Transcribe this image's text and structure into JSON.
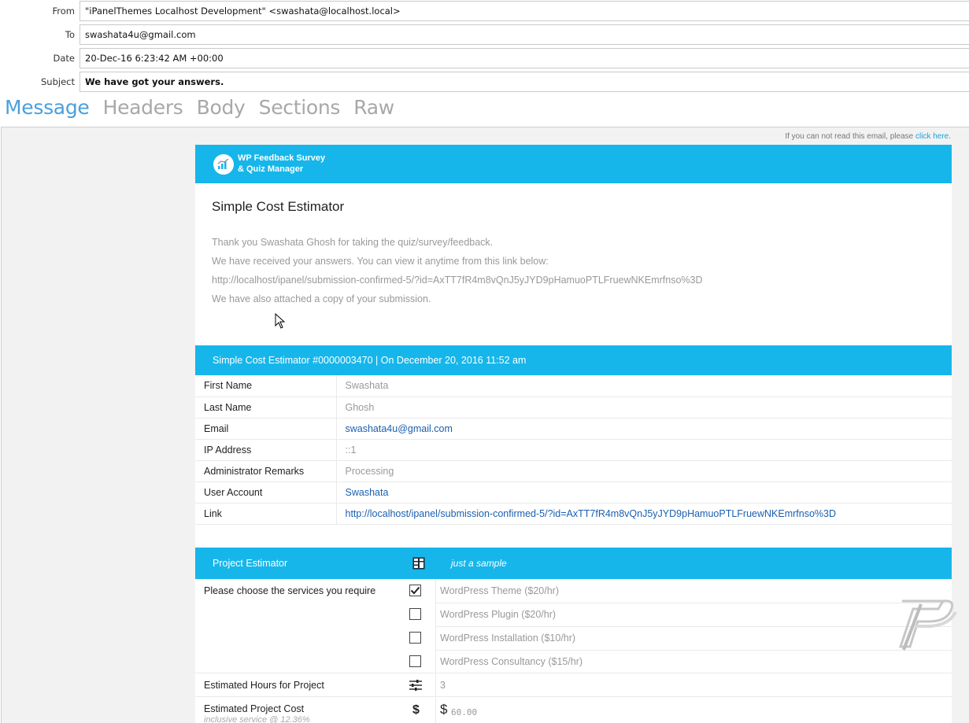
{
  "headers": {
    "from_label": "From",
    "from_value": "\"iPanelThemes Localhost Development\" <swashata@localhost.local>",
    "to_label": "To",
    "to_value": "swashata4u@gmail.com",
    "date_label": "Date",
    "date_value": "20-Dec-16 6:23:42 AM +00:00",
    "subject_label": "Subject",
    "subject_value": "We have got your answers."
  },
  "tabs": [
    "Message",
    "Headers",
    "Body",
    "Sections",
    "Raw"
  ],
  "preview": {
    "cantread_text": "If you can not read this email, please ",
    "cantread_link": "click here.",
    "brand_line1": "WP Feedback Survey",
    "brand_line2": "& Quiz Manager",
    "title": "Simple Cost Estimator",
    "intro": [
      "Thank you Swashata Ghosh for taking the quiz/survey/feedback.",
      "We have received your answers. You can view it anytime from this link below:",
      "http://localhost/ipanel/submission-confirmed-5/?id=AxTT7fR4m8vQnJ5yJYD9pHamuoPTLFruewNKEmrfnso%3D",
      "We have also attached a copy of your submission."
    ],
    "submission_bar": "Simple Cost Estimator #0000003470 | On December 20, 2016 11:52 am",
    "info_rows": [
      {
        "key": "First Name",
        "value": "Swashata"
      },
      {
        "key": "Last Name",
        "value": "Ghosh"
      },
      {
        "key": "Email",
        "value": "swashata4u@gmail.com"
      },
      {
        "key": "IP Address",
        "value": "::1"
      },
      {
        "key": "Administrator Remarks",
        "value": "Processing"
      },
      {
        "key": "User Account",
        "value": "Swashata"
      },
      {
        "key": "Link",
        "value": "http://localhost/ipanel/submission-confirmed-5/?id=AxTT7fR4m8vQnJ5yJYD9pHamuoPTLFruewNKEmrfnso%3D"
      }
    ],
    "project": {
      "title": "Project Estimator",
      "icon": "calculator-icon",
      "subtitle": "just a sample",
      "services_question": "Please choose the services you require",
      "services": [
        {
          "label": "WordPress Theme ($20/hr)",
          "checked": true
        },
        {
          "label": "WordPress Plugin ($20/hr)",
          "checked": false
        },
        {
          "label": "WordPress Installation ($10/hr)",
          "checked": false
        },
        {
          "label": "WordPress Consultancy ($15/hr)",
          "checked": false
        }
      ],
      "hours_question": "Estimated Hours for Project",
      "hours_icon": "sliders-icon",
      "hours_value": "3",
      "cost_question": "Estimated Project Cost",
      "cost_sub": "inclusive service @ 12.36%",
      "cost_icon": "dollar-icon",
      "cost_currency": "$",
      "cost_value": "60.00"
    }
  },
  "colors": {
    "accent": "#16b6ea",
    "tab_active": "#4aa0dc",
    "link": "#1b5fb0"
  }
}
